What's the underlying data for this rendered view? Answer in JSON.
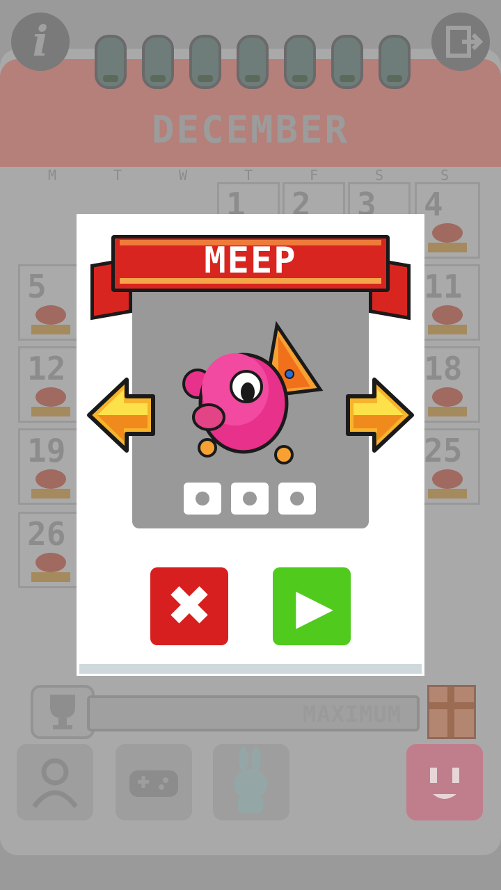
{
  "calendar": {
    "month": "DECEMBER",
    "weekdays": [
      "M",
      "T",
      "W",
      "T",
      "F",
      "S",
      "S"
    ],
    "days": [
      "1",
      "2",
      "3",
      "4",
      "5",
      "11",
      "12",
      "18",
      "19",
      "25",
      "26"
    ]
  },
  "header": {
    "info_glyph": "i",
    "exit_icon": "exit-door-icon"
  },
  "progress": {
    "label": "MAXIMUM"
  },
  "modal": {
    "title": "MEEP",
    "close_glyph": "✖",
    "play_glyph": "▶",
    "colors": {
      "banner": "#d8251f",
      "close": "#d81f1f",
      "play": "#4fca1d",
      "character": "#e8318a",
      "arrow": "#f7b32b"
    }
  }
}
